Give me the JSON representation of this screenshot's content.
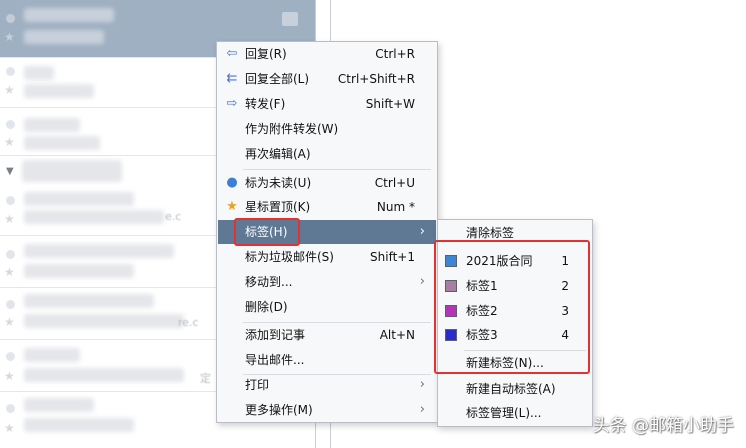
{
  "context_menu": {
    "items": [
      {
        "label": "回复(R)",
        "shortcut": "Ctrl+R",
        "icon": "reply-icon"
      },
      {
        "label": "回复全部(L)",
        "shortcut": "Ctrl+Shift+R",
        "icon": "reply-all-icon"
      },
      {
        "label": "转发(F)",
        "shortcut": "Shift+W",
        "icon": "forward-icon"
      },
      {
        "label": "作为附件转发(W)",
        "shortcut": ""
      },
      {
        "label": "再次编辑(A)",
        "shortcut": ""
      },
      {
        "label": "标为未读(U)",
        "shortcut": "Ctrl+U",
        "icon": "unread-dot-icon"
      },
      {
        "label": "星标置顶(K)",
        "shortcut": "Num *",
        "icon": "star-icon"
      },
      {
        "label": "标签(H)",
        "shortcut": "",
        "submenu": true
      },
      {
        "label": "标为垃圾邮件(S)",
        "shortcut": "Shift+1"
      },
      {
        "label": "移动到...",
        "shortcut": "",
        "submenu": true
      },
      {
        "label": "删除(D)",
        "shortcut": ""
      },
      {
        "label": "添加到记事",
        "shortcut": "Alt+N"
      },
      {
        "label": "导出邮件...",
        "shortcut": ""
      },
      {
        "label": "打印",
        "shortcut": "",
        "submenu": true
      },
      {
        "label": "更多操作(M)",
        "shortcut": "",
        "submenu": true
      }
    ]
  },
  "tag_submenu": {
    "clear_label": "清除标签",
    "tags": [
      {
        "label": "2021版合同",
        "number": "1",
        "color": "#3d86d6"
      },
      {
        "label": "标签1",
        "number": "2",
        "color": "#a87fa3"
      },
      {
        "label": "标签2",
        "number": "3",
        "color": "#b434b9"
      },
      {
        "label": "标签3",
        "number": "4",
        "color": "#2b2bc9"
      }
    ],
    "new_tag_label": "新建标签(N)...",
    "new_auto_tag_label": "新建自动标签(A)",
    "manage_label": "标签管理(L)..."
  },
  "mail_list": {
    "fragments": [
      "e.c",
      "re.c",
      "定"
    ]
  },
  "watermark": "头条 @邮箱小助手"
}
